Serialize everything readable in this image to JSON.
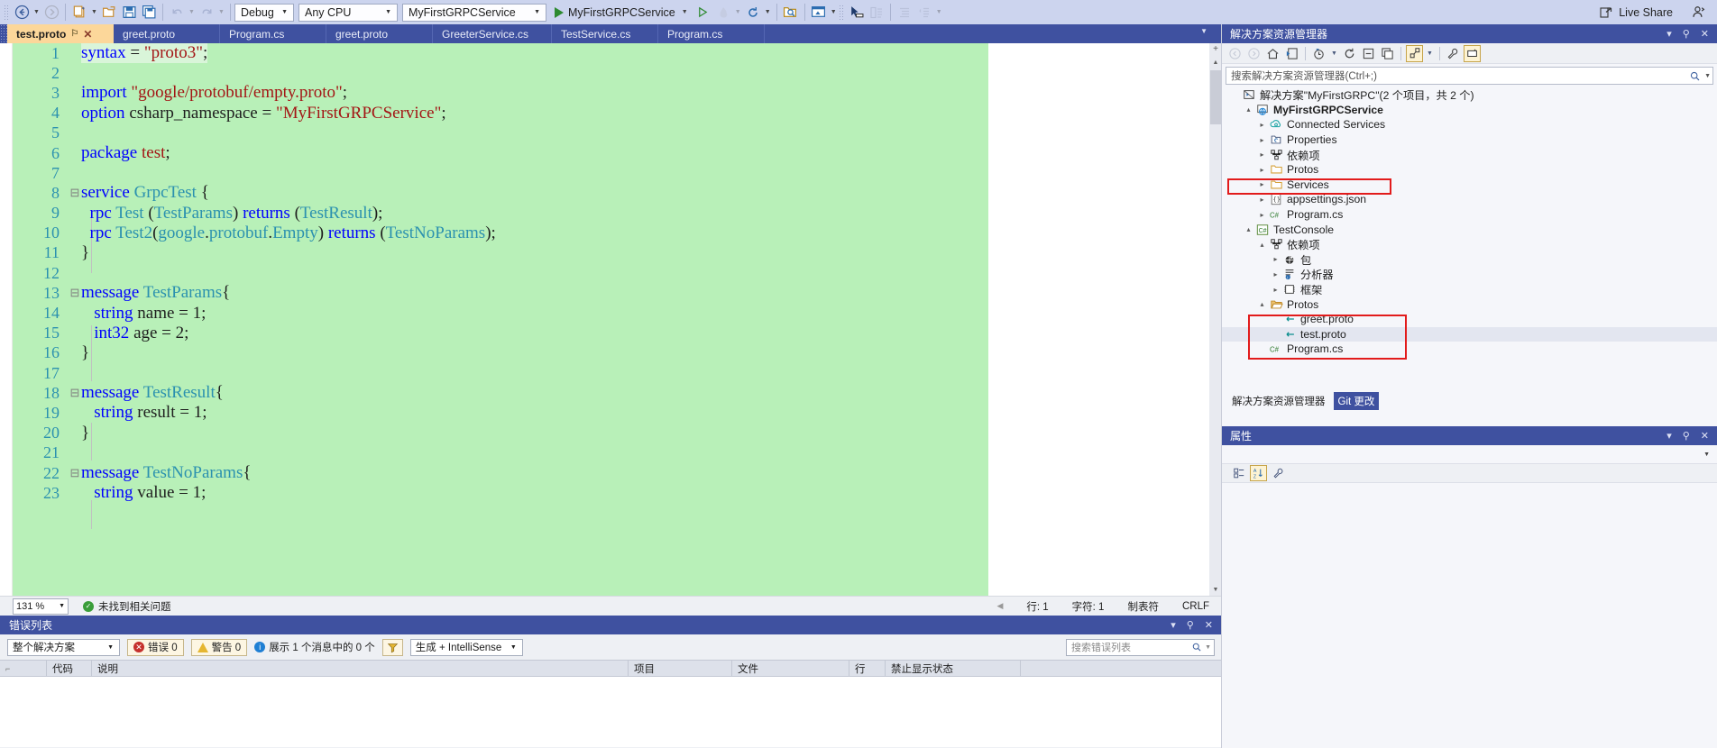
{
  "toolbar": {
    "nav_back": "back-arrow",
    "nav_forward": "forward-arrow",
    "new_item": "new-item",
    "open_file": "open-file",
    "save": "save",
    "save_all": "save-all",
    "undo": "undo",
    "redo": "redo",
    "config_value": "Debug",
    "platform_value": "Any CPU",
    "startup_project_value": "MyFirstGRPCService",
    "run_label": "MyFirstGRPCService",
    "live_share": "Live Share"
  },
  "editor": {
    "tabs": [
      {
        "label": "test.proto",
        "active": true,
        "pin": "⚐",
        "close": "✕"
      },
      {
        "label": "greet.proto",
        "active": false
      },
      {
        "label": "Program.cs",
        "active": false
      },
      {
        "label": "greet.proto",
        "active": false
      },
      {
        "label": "GreeterService.cs",
        "active": false
      },
      {
        "label": "TestService.cs",
        "active": false
      },
      {
        "label": "Program.cs",
        "active": false
      }
    ],
    "lines": [
      {
        "n": "1",
        "fold": "",
        "caret": true,
        "parts": [
          {
            "t": "syntax",
            "c": "kw"
          },
          {
            "t": " = ",
            "c": "pl"
          },
          {
            "t": "\"proto3\"",
            "c": "str"
          },
          {
            "t": ";",
            "c": "pl"
          }
        ]
      },
      {
        "n": "2",
        "fold": "",
        "parts": []
      },
      {
        "n": "3",
        "fold": "",
        "parts": [
          {
            "t": "import",
            "c": "kw"
          },
          {
            "t": " ",
            "c": "pl"
          },
          {
            "t": "\"google/protobuf/empty.proto\"",
            "c": "str"
          },
          {
            "t": ";",
            "c": "pl"
          }
        ]
      },
      {
        "n": "4",
        "fold": "",
        "parts": [
          {
            "t": "option",
            "c": "kw"
          },
          {
            "t": " csharp_namespace = ",
            "c": "pl"
          },
          {
            "t": "\"MyFirstGRPCService\"",
            "c": "str"
          },
          {
            "t": ";",
            "c": "pl"
          }
        ]
      },
      {
        "n": "5",
        "fold": "",
        "parts": []
      },
      {
        "n": "6",
        "fold": "",
        "parts": [
          {
            "t": "package",
            "c": "kw"
          },
          {
            "t": " ",
            "c": "pl"
          },
          {
            "t": "test",
            "c": "str"
          },
          {
            "t": ";",
            "c": "pl"
          }
        ]
      },
      {
        "n": "7",
        "fold": "",
        "parts": []
      },
      {
        "n": "8",
        "fold": "⊟",
        "parts": [
          {
            "t": "service",
            "c": "kw"
          },
          {
            "t": " ",
            "c": "pl"
          },
          {
            "t": "GrpcTest",
            "c": "ty"
          },
          {
            "t": " {",
            "c": "pl"
          }
        ]
      },
      {
        "n": "9",
        "fold": "",
        "parts": [
          {
            "t": "  ",
            "c": "pl"
          },
          {
            "t": "rpc",
            "c": "kw"
          },
          {
            "t": " ",
            "c": "pl"
          },
          {
            "t": "Test",
            "c": "ty"
          },
          {
            "t": " (",
            "c": "pl"
          },
          {
            "t": "TestParams",
            "c": "ty"
          },
          {
            "t": ") ",
            "c": "pl"
          },
          {
            "t": "returns",
            "c": "kw"
          },
          {
            "t": " (",
            "c": "pl"
          },
          {
            "t": "TestResult",
            "c": "ty"
          },
          {
            "t": ");",
            "c": "pl"
          }
        ]
      },
      {
        "n": "10",
        "fold": "",
        "parts": [
          {
            "t": "  ",
            "c": "pl"
          },
          {
            "t": "rpc",
            "c": "kw"
          },
          {
            "t": " ",
            "c": "pl"
          },
          {
            "t": "Test2",
            "c": "ty"
          },
          {
            "t": "(",
            "c": "pl"
          },
          {
            "t": "google",
            "c": "ty"
          },
          {
            "t": ".",
            "c": "pl"
          },
          {
            "t": "protobuf",
            "c": "ty"
          },
          {
            "t": ".",
            "c": "pl"
          },
          {
            "t": "Empty",
            "c": "ty"
          },
          {
            "t": ") ",
            "c": "pl"
          },
          {
            "t": "returns",
            "c": "kw"
          },
          {
            "t": " (",
            "c": "pl"
          },
          {
            "t": "TestNoParams",
            "c": "ty"
          },
          {
            "t": ");",
            "c": "pl"
          }
        ]
      },
      {
        "n": "11",
        "fold": "",
        "parts": [
          {
            "t": "}",
            "c": "pl"
          }
        ]
      },
      {
        "n": "12",
        "fold": "",
        "parts": []
      },
      {
        "n": "13",
        "fold": "⊟",
        "parts": [
          {
            "t": "message",
            "c": "kw"
          },
          {
            "t": " ",
            "c": "pl"
          },
          {
            "t": "TestParams",
            "c": "ty"
          },
          {
            "t": "{",
            "c": "pl"
          }
        ]
      },
      {
        "n": "14",
        "fold": "",
        "parts": [
          {
            "t": "   ",
            "c": "pl"
          },
          {
            "t": "string",
            "c": "kw"
          },
          {
            "t": " name = 1;",
            "c": "pl"
          }
        ]
      },
      {
        "n": "15",
        "fold": "",
        "parts": [
          {
            "t": "   ",
            "c": "pl"
          },
          {
            "t": "int32",
            "c": "kw"
          },
          {
            "t": " age = 2;",
            "c": "pl"
          }
        ]
      },
      {
        "n": "16",
        "fold": "",
        "parts": [
          {
            "t": "}",
            "c": "pl"
          }
        ]
      },
      {
        "n": "17",
        "fold": "",
        "parts": []
      },
      {
        "n": "18",
        "fold": "⊟",
        "parts": [
          {
            "t": "message",
            "c": "kw"
          },
          {
            "t": " ",
            "c": "pl"
          },
          {
            "t": "TestResult",
            "c": "ty"
          },
          {
            "t": "{",
            "c": "pl"
          }
        ]
      },
      {
        "n": "19",
        "fold": "",
        "parts": [
          {
            "t": "   ",
            "c": "pl"
          },
          {
            "t": "string",
            "c": "kw"
          },
          {
            "t": " result = 1;",
            "c": "pl"
          }
        ]
      },
      {
        "n": "20",
        "fold": "",
        "parts": [
          {
            "t": "}",
            "c": "pl"
          }
        ]
      },
      {
        "n": "21",
        "fold": "",
        "parts": []
      },
      {
        "n": "22",
        "fold": "⊟",
        "parts": [
          {
            "t": "message",
            "c": "kw"
          },
          {
            "t": " ",
            "c": "pl"
          },
          {
            "t": "TestNoParams",
            "c": "ty"
          },
          {
            "t": "{",
            "c": "pl"
          }
        ]
      },
      {
        "n": "23",
        "fold": "",
        "parts": [
          {
            "t": "   ",
            "c": "pl"
          },
          {
            "t": "string",
            "c": "kw"
          },
          {
            "t": " value = 1;",
            "c": "pl"
          }
        ]
      }
    ],
    "status": {
      "zoom": "131 %",
      "issues": "未找到相关问题",
      "line": "行: 1",
      "column": "字符: 1",
      "indent": "制表符",
      "eol": "CRLF"
    }
  },
  "error_list": {
    "title": "错误列表",
    "scope": "整个解决方案",
    "errors": "错误 0",
    "warnings": "警告 0",
    "messages": "展示 1 个消息中的 0 个",
    "build_filter": "生成 + IntelliSense",
    "search_placeholder": "搜索错误列表",
    "columns": [
      "代码",
      "说明",
      "项目",
      "文件",
      "行",
      "禁止显示状态"
    ],
    "rows": []
  },
  "solution_explorer": {
    "title": "解决方案资源管理器",
    "search_placeholder": "搜索解决方案资源管理器(Ctrl+;)",
    "tree": [
      {
        "indent": 0,
        "exp": "",
        "icon": "solution-icon",
        "label": "解决方案\"MyFirstGRPC\"(2 个项目，共 2 个)",
        "bold": false
      },
      {
        "indent": 1,
        "exp": "▴",
        "icon": "web-project-icon",
        "label": "MyFirstGRPCService",
        "bold": true
      },
      {
        "indent": 2,
        "exp": "▸",
        "icon": "connected-services-icon",
        "label": "Connected Services",
        "bold": false
      },
      {
        "indent": 2,
        "exp": "▸",
        "icon": "properties-icon",
        "label": "Properties",
        "bold": false
      },
      {
        "indent": 2,
        "exp": "▸",
        "icon": "dependencies-icon",
        "label": "依赖项",
        "bold": false
      },
      {
        "indent": 2,
        "exp": "▸",
        "icon": "folder-icon",
        "label": "Protos",
        "bold": false
      },
      {
        "indent": 2,
        "exp": "▸",
        "icon": "folder-icon",
        "label": "Services",
        "bold": false
      },
      {
        "indent": 2,
        "exp": "▸",
        "icon": "json-icon",
        "label": "appsettings.json",
        "bold": false
      },
      {
        "indent": 2,
        "exp": "▸",
        "icon": "csharp-icon",
        "label": "Program.cs",
        "bold": false
      },
      {
        "indent": 1,
        "exp": "▴",
        "icon": "csharp-project-icon",
        "label": "TestConsole",
        "bold": false
      },
      {
        "indent": 2,
        "exp": "▴",
        "icon": "dependencies-icon",
        "label": "依赖项",
        "bold": false
      },
      {
        "indent": 3,
        "exp": "▸",
        "icon": "package-icon",
        "label": "包",
        "bold": false
      },
      {
        "indent": 3,
        "exp": "▸",
        "icon": "analyzer-icon",
        "label": "分析器",
        "bold": false
      },
      {
        "indent": 3,
        "exp": "▸",
        "icon": "framework-icon",
        "label": "框架",
        "bold": false
      },
      {
        "indent": 2,
        "exp": "▴",
        "icon": "folder-open-icon",
        "label": "Protos",
        "bold": false
      },
      {
        "indent": 3,
        "exp": "",
        "icon": "proto-icon",
        "label": "greet.proto",
        "bold": false
      },
      {
        "indent": 3,
        "exp": "",
        "icon": "proto-icon",
        "label": "test.proto",
        "bold": false,
        "selected": true
      },
      {
        "indent": 2,
        "exp": "",
        "icon": "csharp-icon",
        "label": "Program.cs",
        "bold": false
      }
    ],
    "bottom_tabs": [
      {
        "label": "解决方案资源管理器",
        "active": false
      },
      {
        "label": "Git 更改",
        "active": true
      }
    ]
  },
  "properties": {
    "title": "属性"
  },
  "colors": {
    "chrome_blue": "#3f51a0",
    "toolbar_bg": "#ccd4ee",
    "code_highlight": "#b8f0b8",
    "accent_red": "#e21b1b",
    "keyword": "#0000ff",
    "type": "#2b91af",
    "string": "#a31515"
  }
}
